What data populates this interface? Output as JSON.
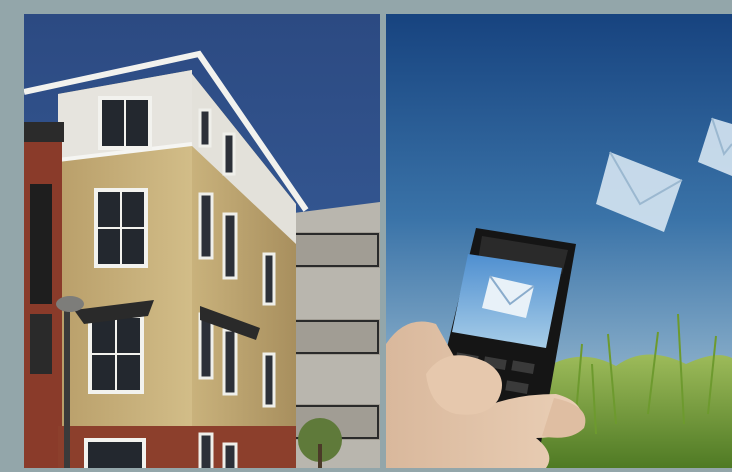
{
  "scene": {
    "left_photo": {
      "subject": "apartment-building",
      "sky_color": "#2f4f86",
      "siding_color": "#c9b27c",
      "brick_color": "#8a3b2a"
    },
    "right_photo": {
      "subject": "hand-holding-mobile-phone",
      "sky_top_color": "#1c4a86",
      "sky_bottom_color": "#a9c6d8",
      "grass_color": "#7fa33a"
    }
  }
}
